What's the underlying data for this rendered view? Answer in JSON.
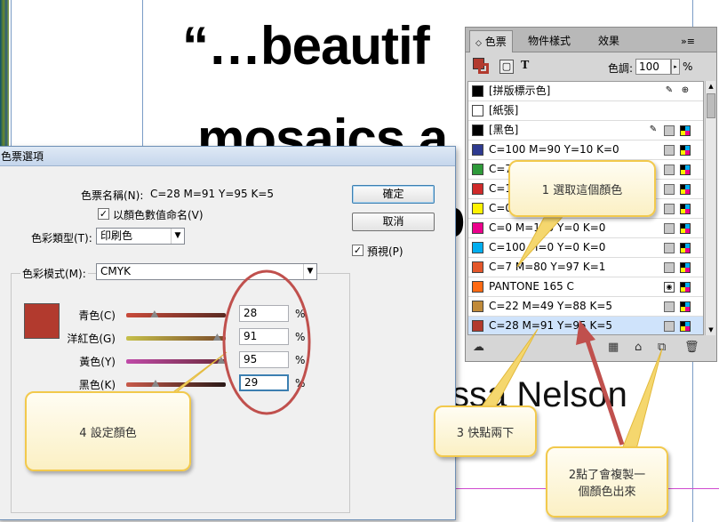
{
  "document": {
    "headline_line1": "“…beautif",
    "headline_line2": "mosaics a",
    "headline_line3": "p",
    "byline": "ssa Nelson"
  },
  "dialog": {
    "title": "色票選項",
    "swatch_name_label": "色票名稱(N):",
    "swatch_name_value": "C=28 M=91 Y=95 K=5",
    "name_with_value_label": "以顏色數值命名(V)",
    "name_with_value_checked": true,
    "color_type_label": "色彩類型(T):",
    "color_type_value": "印刷色",
    "color_mode_label": "色彩模式(M):",
    "color_mode_value": "CMYK",
    "ok_button": "確定",
    "cancel_button": "取消",
    "preview_label": "預視(P)",
    "preview_checked": true,
    "swatch_color": "#b23a2e",
    "percent_sign": "%",
    "channels": [
      {
        "label": "青色(C)",
        "value": "28",
        "track": "linear-gradient(90deg,#c94a3a,#5a2a22)",
        "level": 0.28
      },
      {
        "label": "洋紅色(G)",
        "value": "91",
        "track": "linear-gradient(90deg,#c6c04a,#7a4a2a)",
        "level": 0.91
      },
      {
        "label": "黃色(Y)",
        "value": "95",
        "track": "linear-gradient(90deg,#c04aa8,#6a2a3a)",
        "level": 0.95
      },
      {
        "label": "黑色(K)",
        "value": "29",
        "track": "linear-gradient(90deg,#c85a4a,#2a1a18)",
        "level": 0.29
      }
    ]
  },
  "panel": {
    "tabs": [
      "色票",
      "物件樣式",
      "效果"
    ],
    "active_tab": "色票",
    "menu_glyph": "»≡",
    "text_glyph": "T",
    "tint_label": "色調:",
    "tint_value": "100",
    "tint_unit": "%",
    "swatches": [
      {
        "name": "[拼版標示色]",
        "color": "#000000",
        "icons": [
          "no-edit",
          "registration"
        ]
      },
      {
        "name": "[紙張]",
        "color": "#ffffff",
        "icons": []
      },
      {
        "name": "[黑色]",
        "color": "#000000",
        "icons": [
          "no-edit",
          "gray",
          "cmyk"
        ]
      },
      {
        "name": "C=100 M=90 Y=10 K=0",
        "color": "#2e3a8f",
        "icons": [
          "gray",
          "cmyk"
        ]
      },
      {
        "name": "C=7",
        "color": "#2e9a3a",
        "icons": [
          "gray",
          "cmyk"
        ]
      },
      {
        "name": "C=1",
        "color": "#d02a2a",
        "icons": [
          "gray",
          "cmyk"
        ]
      },
      {
        "name": "C=0",
        "color": "#fff200",
        "icons": [
          "gray",
          "cmyk"
        ]
      },
      {
        "name": "C=0 M=100 Y=0 K=0",
        "color": "#ec008c",
        "icons": [
          "gray",
          "cmyk"
        ]
      },
      {
        "name": "C=100 M=0 Y=0 K=0",
        "color": "#00aeef",
        "icons": [
          "gray",
          "cmyk"
        ]
      },
      {
        "name": "C=7 M=80 Y=97 K=1",
        "color": "#e4572a",
        "icons": [
          "gray",
          "cmyk"
        ]
      },
      {
        "name": "PANTONE 165 C",
        "color": "#ff6a13",
        "icons": [
          "spot",
          "cmyk"
        ]
      },
      {
        "name": "C=22 M=49 Y=88 K=5",
        "color": "#c08a3a",
        "icons": [
          "gray",
          "cmyk"
        ]
      },
      {
        "name": "C=28 M=91 Y=95 K=5",
        "color": "#b23a2e",
        "icons": [
          "gray",
          "cmyk"
        ],
        "selected": true
      }
    ]
  },
  "callouts": {
    "c1": "1 選取這個顏色",
    "c2_line1": "2點了會複製一",
    "c2_line2": "個顏色出來",
    "c3": "3 快點兩下",
    "c4": "4 設定顏色"
  }
}
